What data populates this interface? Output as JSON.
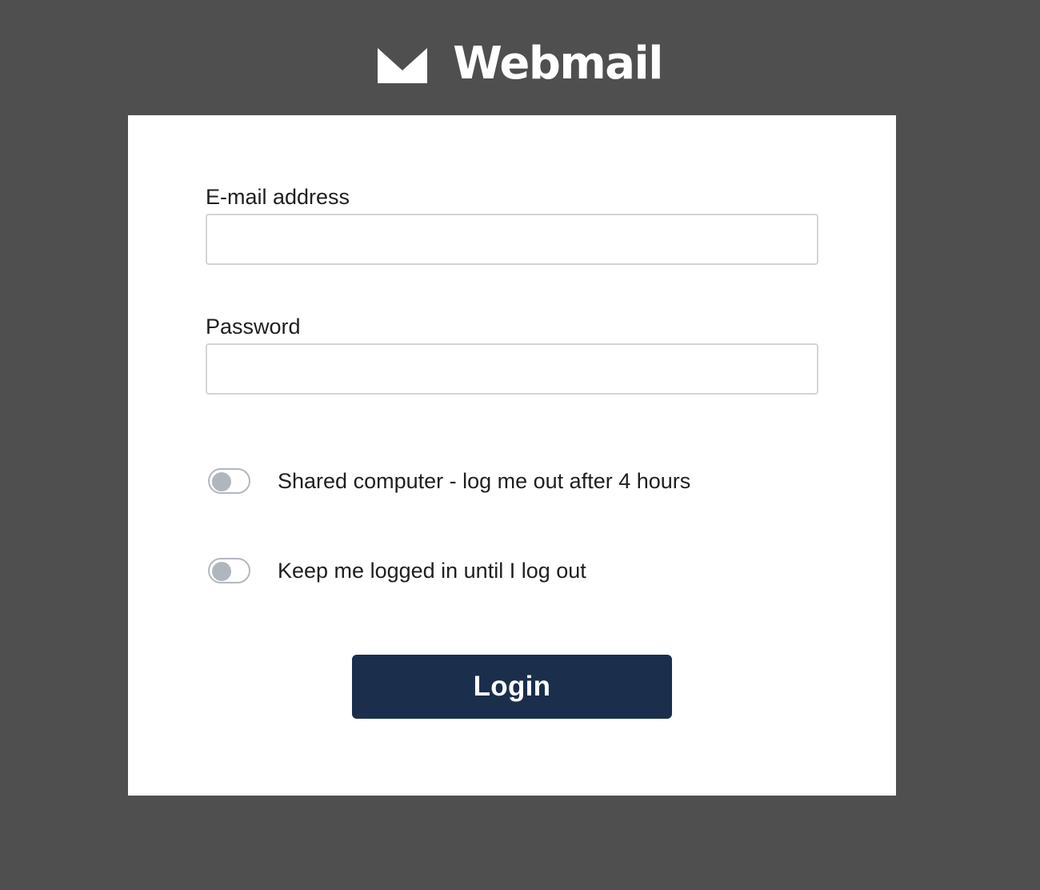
{
  "header": {
    "logo_icon": "envelope-icon",
    "brand": "Webmail"
  },
  "form": {
    "email": {
      "label": "E-mail address",
      "value": "",
      "placeholder": ""
    },
    "password": {
      "label": "Password",
      "value": "",
      "placeholder": ""
    },
    "shared_computer": {
      "label": "Shared computer - log me out after 4 hours",
      "checked": false
    },
    "keep_logged_in": {
      "label": "Keep me logged in until I log out",
      "checked": false
    },
    "login_label": "Login"
  },
  "colors": {
    "page_background": "#4f4f4f",
    "card_background": "#ffffff",
    "button_background": "#1b2e4b",
    "toggle_off": "#b0b6be"
  }
}
